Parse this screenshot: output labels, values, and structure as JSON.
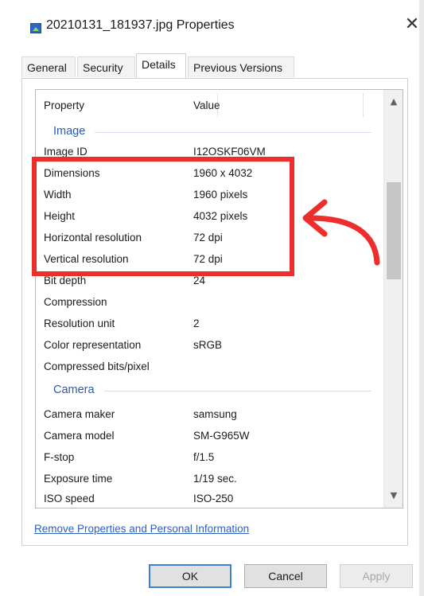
{
  "window": {
    "title": "20210131_181937.jpg Properties",
    "close_symbol": "✕"
  },
  "tabs": [
    {
      "label": "General"
    },
    {
      "label": "Security"
    },
    {
      "label": "Details",
      "active": true
    },
    {
      "label": "Previous Versions"
    }
  ],
  "details": {
    "columns": {
      "property": "Property",
      "value": "Value"
    },
    "groups": {
      "image": "Image",
      "camera": "Camera"
    },
    "image_rows": [
      {
        "property": "Image ID",
        "value": "I12OSKF06VM"
      },
      {
        "property": "Dimensions",
        "value": "1960 x 4032"
      },
      {
        "property": "Width",
        "value": "1960 pixels"
      },
      {
        "property": "Height",
        "value": "4032 pixels"
      },
      {
        "property": "Horizontal resolution",
        "value": "72 dpi"
      },
      {
        "property": "Vertical resolution",
        "value": "72 dpi"
      },
      {
        "property": "Bit depth",
        "value": "24"
      },
      {
        "property": "Compression",
        "value": ""
      },
      {
        "property": "Resolution unit",
        "value": "2"
      },
      {
        "property": "Color representation",
        "value": "sRGB"
      },
      {
        "property": "Compressed bits/pixel",
        "value": ""
      }
    ],
    "camera_rows": [
      {
        "property": "Camera maker",
        "value": "samsung"
      },
      {
        "property": "Camera model",
        "value": "SM-G965W"
      },
      {
        "property": "F-stop",
        "value": "f/1.5"
      },
      {
        "property": "Exposure time",
        "value": "1/19 sec."
      },
      {
        "property": "ISO speed",
        "value": "ISO-250"
      }
    ],
    "scroll_up_symbol": "▲",
    "scroll_down_symbol": "▼"
  },
  "link": {
    "label": "Remove Properties and Personal Information"
  },
  "buttons": {
    "ok": "OK",
    "cancel": "Cancel",
    "apply": "Apply"
  },
  "annotation": {
    "highlight_color": "#ee2d2d"
  },
  "colors": {
    "accent": "#2d5fc4",
    "group_header": "#2a59b5"
  }
}
